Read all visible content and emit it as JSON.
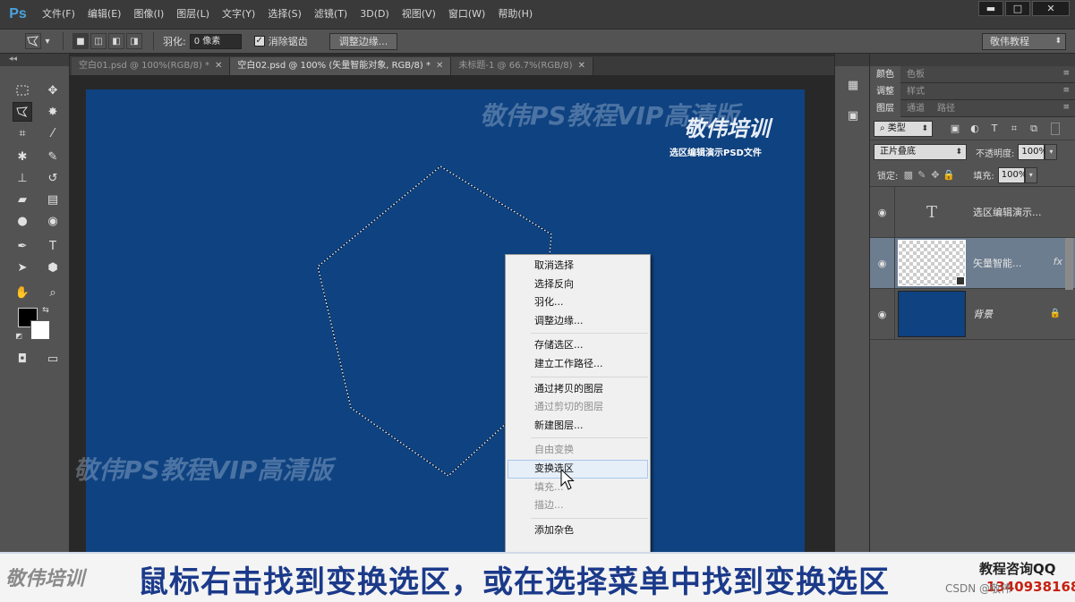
{
  "app": {
    "logo": "Ps",
    "menus": [
      "文件(F)",
      "编辑(E)",
      "图像(I)",
      "图层(L)",
      "文字(Y)",
      "选择(S)",
      "滤镜(T)",
      "3D(D)",
      "视图(V)",
      "窗口(W)",
      "帮助(H)"
    ],
    "window_controls": [
      "▬",
      "□",
      "✕"
    ]
  },
  "options_bar": {
    "feather_label": "羽化:",
    "feather_value": "0 像素",
    "antialias_label": "消除锯齿",
    "antialias_checked": true,
    "refine_edge_button": "调整边缘...",
    "workspace": "敬伟教程"
  },
  "doc_tabs": [
    {
      "title": "空白01.psd @ 100%(RGB/8) *",
      "active": false
    },
    {
      "title": "空白02.psd @ 100% (矢量智能对象, RGB/8) *",
      "active": true
    },
    {
      "title": "未标题-1 @ 66.7%(RGB/8)",
      "active": false
    }
  ],
  "canvas": {
    "background_color": "#0f4280",
    "watermark": "敬伟PS教程VIP高清版",
    "badge_title": "敬伟培训",
    "badge_subtitle": "选区编辑演示PSD文件"
  },
  "context_menu": {
    "groups": [
      [
        {
          "label": "取消选择",
          "disabled": false
        },
        {
          "label": "选择反向",
          "disabled": false
        },
        {
          "label": "羽化...",
          "disabled": false
        },
        {
          "label": "调整边缘...",
          "disabled": false
        }
      ],
      [
        {
          "label": "存储选区...",
          "disabled": false
        },
        {
          "label": "建立工作路径...",
          "disabled": false
        }
      ],
      [
        {
          "label": "通过拷贝的图层",
          "disabled": false
        },
        {
          "label": "通过剪切的图层",
          "disabled": true
        },
        {
          "label": "新建图层...",
          "disabled": false
        }
      ],
      [
        {
          "label": "自由变换",
          "disabled": true
        },
        {
          "label": "变换选区",
          "disabled": false,
          "hover": true
        },
        {
          "label": "填充...",
          "disabled": true
        },
        {
          "label": "描边...",
          "disabled": true
        }
      ],
      [
        {
          "label": "添加杂色",
          "disabled": false
        }
      ]
    ]
  },
  "panels": {
    "group1_tabs": [
      "颜色",
      "色板"
    ],
    "group2_tabs": [
      "调整",
      "样式"
    ],
    "layers_tabs": [
      "图层",
      "通道",
      "路径"
    ],
    "filter_type": "类型",
    "blend_mode": "正片叠底",
    "opacity_label": "不透明度:",
    "opacity_value": "100%",
    "lock_label": "锁定:",
    "fill_label": "填充:",
    "fill_value": "100%",
    "layers": [
      {
        "name": "选区编辑演示...",
        "kind": "text",
        "selected": false
      },
      {
        "name": "矢量智能...",
        "kind": "smart",
        "selected": true,
        "fx": "fx"
      },
      {
        "name": "背景",
        "kind": "background",
        "selected": false
      }
    ]
  },
  "subtitle": {
    "logo": "敬伟培训",
    "text": "鼠标右击找到变换选区，或在选择菜单中找到变换选区",
    "qq_label": "教程咨询QQ",
    "qq_number": "1340938168",
    "csdn": "CSDN @敬伟"
  },
  "colors": {
    "accent_ps": "#4aa3df",
    "subtitle_text": "#1b3a8a",
    "qq_red": "#c82010"
  }
}
